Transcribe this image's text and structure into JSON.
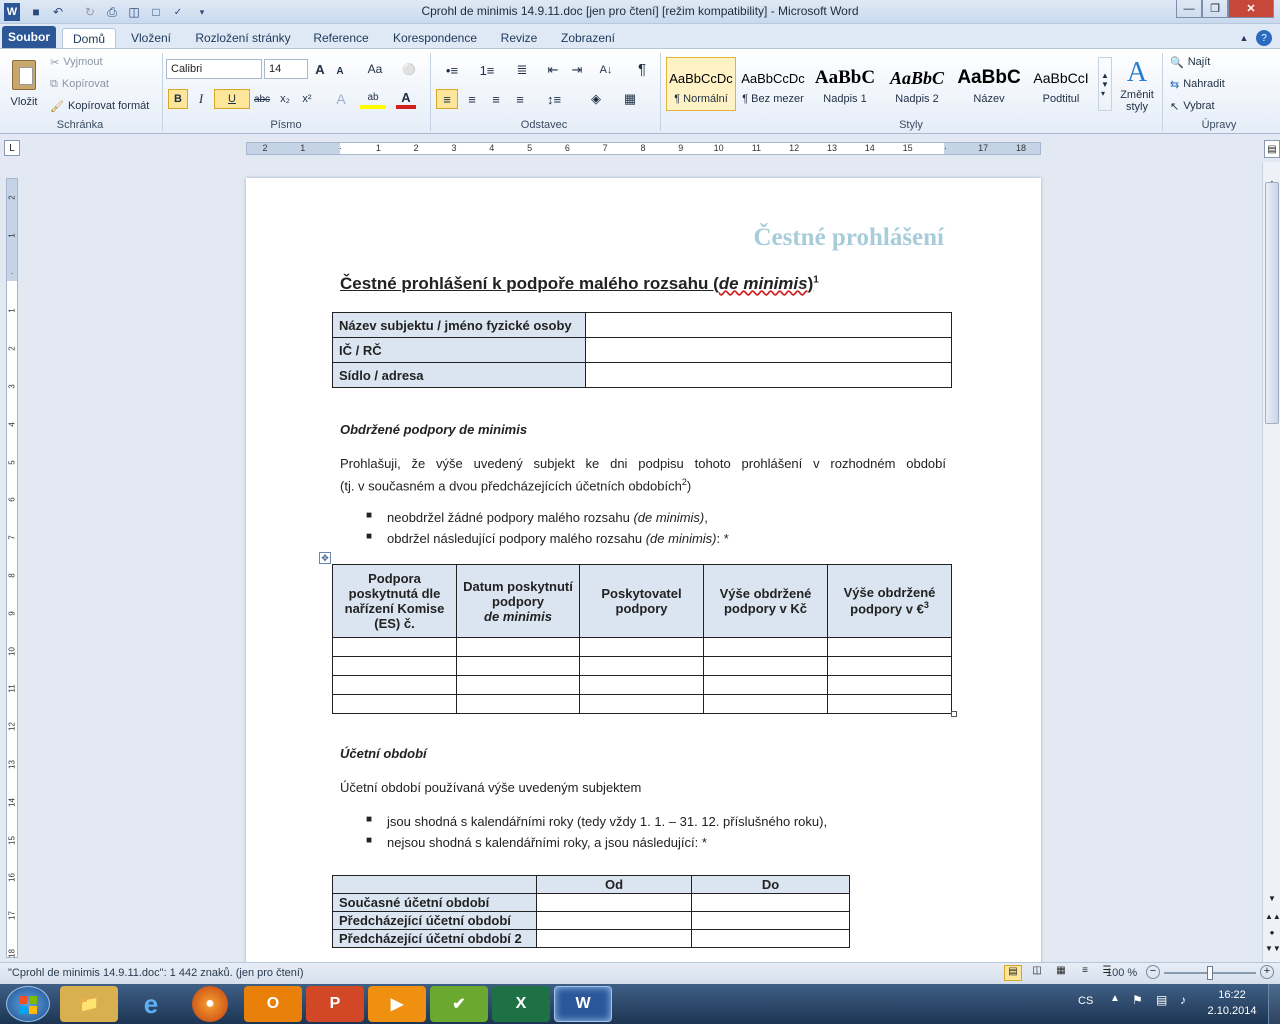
{
  "window": {
    "title": "Cprohl de minimis 14.9.11.doc [jen pro čtení] [režim kompatibility]  -  Microsoft Word"
  },
  "tabs": {
    "file": "Soubor",
    "home": "Domů",
    "insert": "Vložení",
    "layout": "Rozložení stránky",
    "references": "Reference",
    "mailings": "Korespondence",
    "review": "Revize",
    "view": "Zobrazení"
  },
  "clipboard": {
    "paste": "Vložit",
    "cut": "Vyjmout",
    "copy": "Kopírovat",
    "format_painter": "Kopírovat formát",
    "label": "Schránka"
  },
  "font": {
    "name": "Calibri",
    "size": "14",
    "label": "Písmo",
    "bold": "B",
    "italic": "I",
    "underline": "U",
    "strike": "abc",
    "sub": "x₂",
    "sup": "x²",
    "grow": "A",
    "shrink": "A",
    "case": "Aa",
    "color_letter": "A",
    "highlight_letter": "ab"
  },
  "paragraph": {
    "label": "Odstavec",
    "pilcrow": "¶"
  },
  "styles": {
    "label": "Styly",
    "items": [
      {
        "preview": "AaBbCcDc",
        "name": "¶ Normální"
      },
      {
        "preview": "AaBbCcDc",
        "name": "¶ Bez mezer"
      },
      {
        "preview": "AaBbC",
        "name": "Nadpis 1"
      },
      {
        "preview": "AaBbC",
        "name": "Nadpis 2"
      },
      {
        "preview": "AaBbC",
        "name": "Název"
      },
      {
        "preview": "AaBbCcI",
        "name": "Podtitul"
      }
    ],
    "change_line1": "Změnit",
    "change_line2": "styly"
  },
  "editing": {
    "label": "Úpravy",
    "find": "Najít",
    "replace": "Nahradit",
    "select": "Vybrat"
  },
  "ruler": {
    "h_ticks": [
      "2",
      "1",
      "",
      "1",
      "2",
      "3",
      "4",
      "5",
      "6",
      "7",
      "8",
      "9",
      "10",
      "11",
      "12",
      "13",
      "14",
      "15",
      "",
      "17",
      "18"
    ],
    "v_ticks": [
      "2",
      "1",
      "",
      "1",
      "2",
      "3",
      "4",
      "5",
      "6",
      "7",
      "8",
      "9",
      "10",
      "11",
      "12",
      "13",
      "14",
      "15",
      "16",
      "17",
      "18"
    ]
  },
  "document": {
    "header_title": "Čestné prohlášení",
    "heading_main": "Čestné prohlášení k podpoře malého rozsahu (",
    "heading_italic": "de minimis",
    "heading_close": ")",
    "heading_sup": "1",
    "info_rows": [
      "Název subjektu / jméno fyzické osoby",
      "IČ / RČ",
      "Sídlo / adresa"
    ],
    "section1_title": "Obdržené podpory de minimis",
    "para1_line1": "Prohlašuji, že výše uvedený subjekt ke dni podpisu tohoto prohlášení v rozhodném období",
    "para1_line2": "(tj. v současném a dvou předcházejících účetních obdobích",
    "para1_sup": "2",
    "para1_end": ")",
    "bullet1a": "neobdržel žádné podpory malého rozsahu ",
    "bullet1a_it": "(de minimis)",
    "bullet1a_end": ",",
    "bullet1b": "obdržel následující podpory malého rozsahu ",
    "bullet1b_it": "(de minimis)",
    "bullet1b_end": ": *",
    "aid_headers": {
      "c1": "Podpora poskytnutá dle nařízení Komise (ES) č.",
      "c2a": "Datum poskytnutí podpory",
      "c2b": "de minimis",
      "c3": "Poskytovatel podpory",
      "c4": "Výše obdržené podpory v Kč",
      "c5": "Výše obdržené podpory v €",
      "c5_sup": "3"
    },
    "section2_title": "Účetní období",
    "para2": "Účetní období používaná výše uvedeným subjektem",
    "bullet2a": "jsou shodná s kalendářními roky (tedy vždy 1. 1. – 31. 12. příslušného roku),",
    "bullet2b": "nejsou shodná s kalendářními roky, a jsou následující: *",
    "period_headers": [
      "",
      "Od",
      "Do"
    ],
    "period_rows": [
      "Současné účetní období",
      "Předcházející účetní období",
      "Předcházející účetní období 2"
    ]
  },
  "status": {
    "text": "\"Cprohl de minimis 14.9.11.doc\": 1 442 znaků. (jen pro čtení)",
    "zoom": "100 %",
    "zoom_level_percent": 100
  },
  "tray": {
    "lang": "CS",
    "time": "16:22",
    "date": "2.10.2014"
  },
  "colors": {
    "file_tab": "#2b5797",
    "header_title": "#a6cdd9",
    "table_shade": "#dbe5f1"
  }
}
